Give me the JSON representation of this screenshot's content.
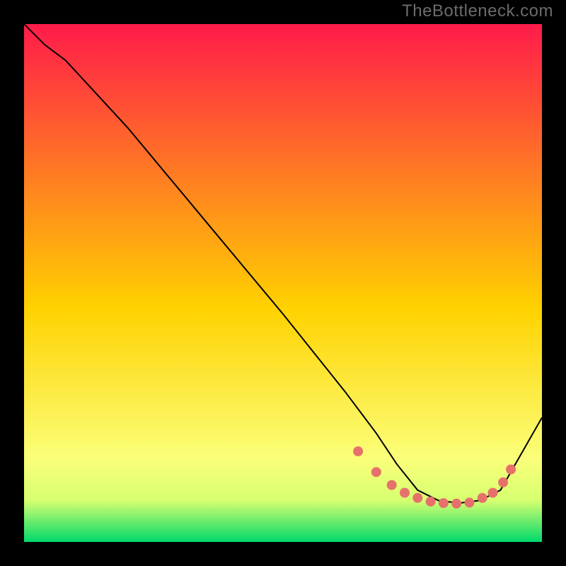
{
  "watermark": "TheBottleneck.com",
  "colors": {
    "top": "#ff1b4a",
    "mid": "#ffd200",
    "pale": "#f8ffb2",
    "green": "#00d96b",
    "line": "#000000",
    "marker": "#e6716b"
  },
  "chart_data": {
    "type": "line",
    "title": "",
    "xlabel": "",
    "ylabel": "",
    "xlim": [
      0,
      100
    ],
    "ylim": [
      0,
      100
    ],
    "grid": false,
    "legend": false,
    "series": [
      {
        "name": "curve",
        "x": [
          0,
          4,
          8,
          20,
          35,
          50,
          62,
          68,
          72,
          76,
          80,
          84,
          88,
          92,
          100
        ],
        "y": [
          100,
          96,
          93,
          80,
          62,
          44,
          29,
          21,
          15,
          10,
          8,
          7.5,
          8,
          10,
          24
        ]
      }
    ],
    "markers": {
      "name": "highlight",
      "x": [
        64.5,
        68,
        71,
        73.5,
        76,
        78.5,
        81,
        83.5,
        86,
        88.5,
        90.5,
        92.5,
        94
      ],
      "y": [
        17.5,
        13.5,
        11,
        9.5,
        8.5,
        7.8,
        7.5,
        7.4,
        7.6,
        8.5,
        9.5,
        11.5,
        14
      ]
    }
  }
}
